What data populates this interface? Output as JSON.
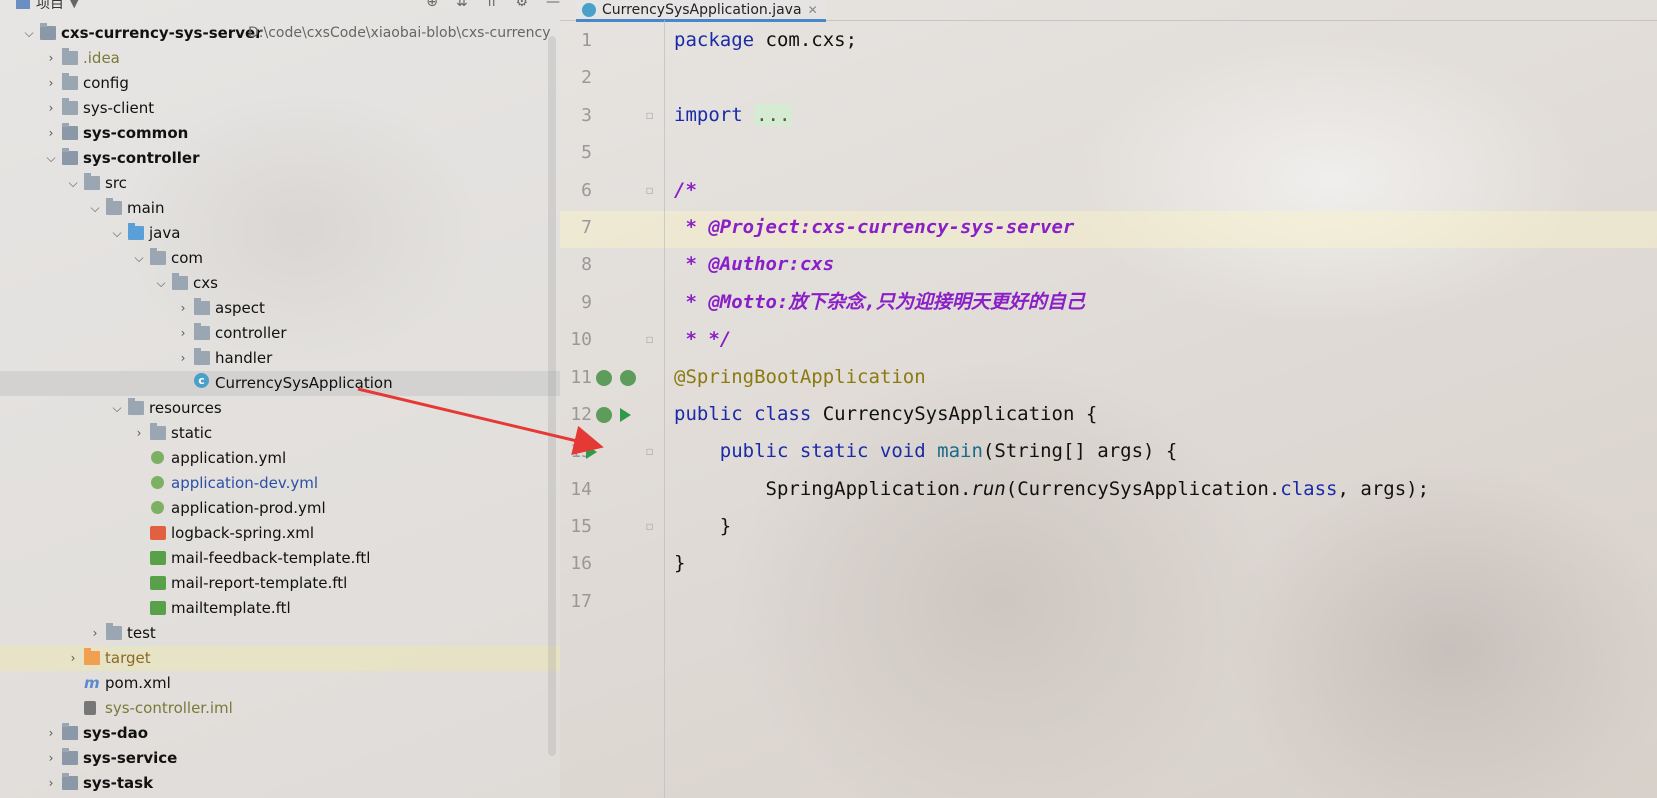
{
  "project_panel": {
    "title": "项目",
    "tree": [
      {
        "label": "cxs-currency-sys-server",
        "path": "D:\\code\\cxsCode\\xiaobai-blob\\cxs-currency",
        "depth": 0,
        "type": "module",
        "expanded": true,
        "bold": true
      },
      {
        "label": ".idea",
        "depth": 1,
        "type": "folder",
        "expanded": false,
        "style": "olive"
      },
      {
        "label": "config",
        "depth": 1,
        "type": "folder",
        "expanded": false
      },
      {
        "label": "sys-client",
        "depth": 1,
        "type": "folder",
        "expanded": false
      },
      {
        "label": "sys-common",
        "depth": 1,
        "type": "module",
        "expanded": false,
        "bold": true
      },
      {
        "label": "sys-controller",
        "depth": 1,
        "type": "module",
        "expanded": true,
        "bold": true
      },
      {
        "label": "src",
        "depth": 2,
        "type": "folder",
        "expanded": true
      },
      {
        "label": "main",
        "depth": 3,
        "type": "folder",
        "expanded": true
      },
      {
        "label": "java",
        "depth": 4,
        "type": "folder-blue",
        "expanded": true
      },
      {
        "label": "com",
        "depth": 5,
        "type": "folder",
        "expanded": true
      },
      {
        "label": "cxs",
        "depth": 6,
        "type": "folder",
        "expanded": true
      },
      {
        "label": "aspect",
        "depth": 7,
        "type": "folder",
        "expanded": false
      },
      {
        "label": "controller",
        "depth": 7,
        "type": "folder",
        "expanded": false
      },
      {
        "label": "handler",
        "depth": 7,
        "type": "folder",
        "expanded": false
      },
      {
        "label": "CurrencySysApplication",
        "depth": 7,
        "type": "class",
        "leaf": true,
        "selected": true
      },
      {
        "label": "resources",
        "depth": 4,
        "type": "folder-res",
        "expanded": true
      },
      {
        "label": "static",
        "depth": 5,
        "type": "folder",
        "expanded": false
      },
      {
        "label": "application.yml",
        "depth": 5,
        "type": "yml",
        "leaf": true
      },
      {
        "label": "application-dev.yml",
        "depth": 5,
        "type": "yml",
        "leaf": true,
        "style": "blue"
      },
      {
        "label": "application-prod.yml",
        "depth": 5,
        "type": "yml",
        "leaf": true
      },
      {
        "label": "logback-spring.xml",
        "depth": 5,
        "type": "xml",
        "leaf": true
      },
      {
        "label": "mail-feedback-template.ftl",
        "depth": 5,
        "type": "ftl",
        "leaf": true
      },
      {
        "label": "mail-report-template.ftl",
        "depth": 5,
        "type": "ftl",
        "leaf": true
      },
      {
        "label": "mailtemplate.ftl",
        "depth": 5,
        "type": "ftl",
        "leaf": true
      },
      {
        "label": "test",
        "depth": 3,
        "type": "folder",
        "expanded": false
      },
      {
        "label": "target",
        "depth": 2,
        "type": "folder-orange",
        "expanded": false,
        "style": "orange",
        "highlight": true
      },
      {
        "label": "pom.xml",
        "depth": 2,
        "type": "pom",
        "leaf": true
      },
      {
        "label": "sys-controller.iml",
        "depth": 2,
        "type": "iml",
        "leaf": true,
        "style": "olive"
      },
      {
        "label": "sys-dao",
        "depth": 1,
        "type": "module",
        "expanded": false,
        "bold": true
      },
      {
        "label": "sys-service",
        "depth": 1,
        "type": "module",
        "expanded": false,
        "bold": true
      },
      {
        "label": "sys-task",
        "depth": 1,
        "type": "module",
        "expanded": false,
        "bold": true
      }
    ]
  },
  "editor": {
    "tab_label": "CurrencySysApplication.java",
    "lines": [
      {
        "n": "1",
        "parts": [
          {
            "t": "package",
            "c": "kw"
          },
          {
            "t": " com.cxs;",
            "c": ""
          }
        ]
      },
      {
        "n": "2",
        "parts": []
      },
      {
        "n": "3",
        "parts": [
          {
            "t": "import",
            "c": "kw"
          },
          {
            "t": " ",
            "c": ""
          },
          {
            "t": "...",
            "c": "dots"
          }
        ],
        "fold": true
      },
      {
        "n": "5",
        "parts": []
      },
      {
        "n": "6",
        "parts": [
          {
            "t": "/*",
            "c": "cm"
          }
        ],
        "fold": true
      },
      {
        "n": "7",
        "parts": [
          {
            "t": " * @Project:cxs-currency-sys-server",
            "c": "cm"
          }
        ]
      },
      {
        "n": "8",
        "parts": [
          {
            "t": " * @Author:cxs",
            "c": "cm"
          }
        ]
      },
      {
        "n": "9",
        "parts": [
          {
            "t": " * @Motto:放下杂念,只为迎接明天更好的自己",
            "c": "cm"
          }
        ]
      },
      {
        "n": "10",
        "parts": [
          {
            "t": " * */",
            "c": "cm"
          }
        ],
        "fold": true
      },
      {
        "n": "11",
        "parts": [
          {
            "t": "@SpringBootApplication",
            "c": "ann"
          }
        ],
        "gutter": [
          "bean",
          "bean"
        ]
      },
      {
        "n": "12",
        "parts": [
          {
            "t": "public class",
            "c": "kw"
          },
          {
            "t": " CurrencySysApplication {",
            "c": ""
          }
        ],
        "gutter": [
          "bean",
          "run"
        ]
      },
      {
        "n": "13",
        "parts": [
          {
            "t": "    ",
            "c": ""
          },
          {
            "t": "public static void",
            "c": "kw"
          },
          {
            "t": " ",
            "c": ""
          },
          {
            "t": "main",
            "c": "fn"
          },
          {
            "t": "(String[] args) {",
            "c": ""
          }
        ],
        "gutter": [
          "run"
        ],
        "fold": true
      },
      {
        "n": "14",
        "parts": [
          {
            "t": "        SpringApplication.",
            "c": ""
          },
          {
            "t": "run",
            "c": "it"
          },
          {
            "t": "(CurrencySysApplication.",
            "c": ""
          },
          {
            "t": "class",
            "c": "kw"
          },
          {
            "t": ", args);",
            "c": ""
          }
        ]
      },
      {
        "n": "15",
        "parts": [
          {
            "t": "    }",
            "c": ""
          }
        ],
        "fold": true
      },
      {
        "n": "16",
        "parts": [
          {
            "t": "}",
            "c": ""
          }
        ]
      },
      {
        "n": "17",
        "parts": []
      }
    ]
  },
  "colors": {
    "keyword": "#1a2aa8",
    "comment": "#8a1fc8",
    "annotation": "#8a7a10",
    "run_icon": "#2e9a4a",
    "arrow": "#e53935"
  }
}
